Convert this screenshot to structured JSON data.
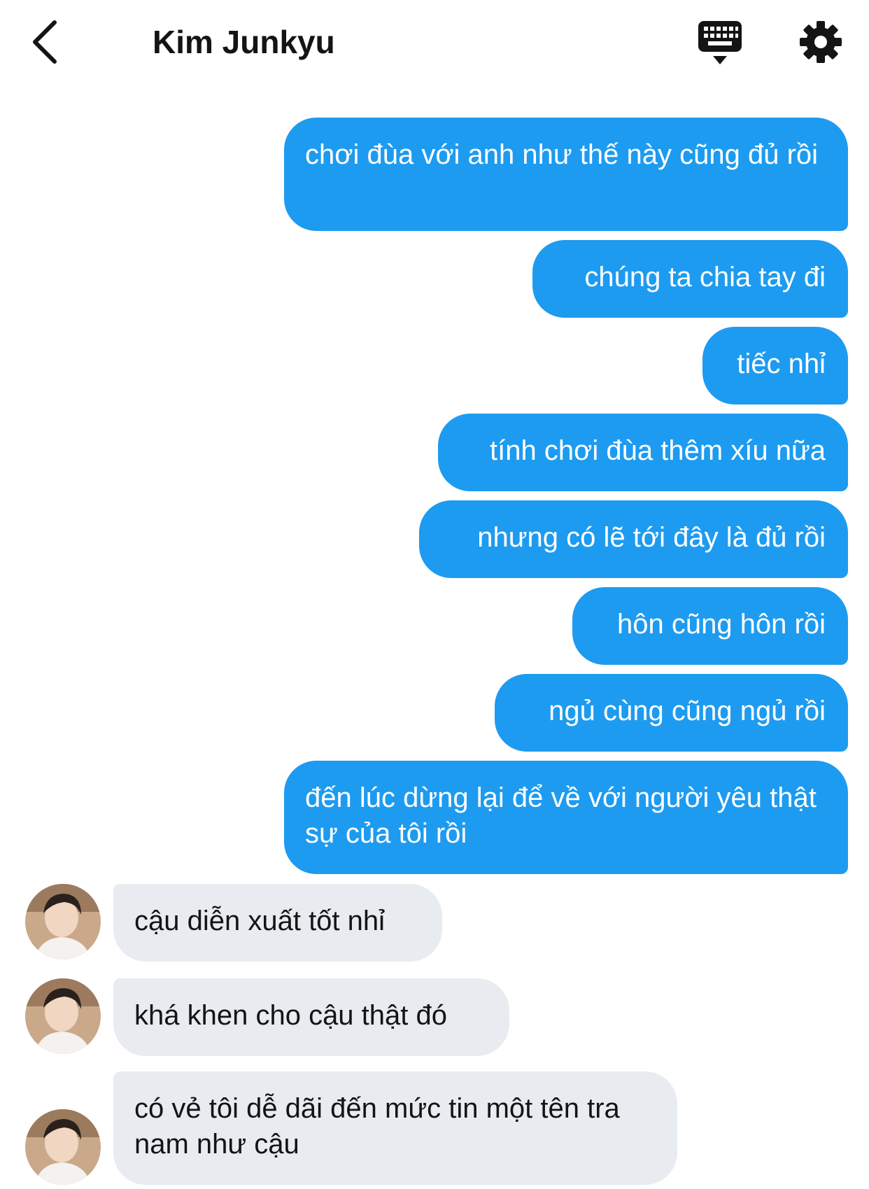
{
  "header": {
    "back_icon": "chevron-left-icon",
    "title": "Kim Junkyu",
    "keyboard_icon": "keyboard-icon",
    "settings_icon": "gear-icon"
  },
  "colors": {
    "sent_bubble": "#1d9bf0",
    "received_bubble": "#e8ecf1",
    "text_dark": "#141414"
  },
  "messages": [
    {
      "direction": "sent",
      "text": "chơi đùa với anh như thế này cũng đủ rồi"
    },
    {
      "direction": "sent",
      "text": "chúng ta chia tay đi"
    },
    {
      "direction": "sent",
      "text": "tiếc nhỉ"
    },
    {
      "direction": "sent",
      "text": "tính chơi đùa thêm xíu nữa"
    },
    {
      "direction": "sent",
      "text": "nhưng có lẽ tới đây là đủ rồi"
    },
    {
      "direction": "sent",
      "text": "hôn cũng hôn rồi"
    },
    {
      "direction": "sent",
      "text": "ngủ cùng cũng ngủ rồi"
    },
    {
      "direction": "sent",
      "text": "đến lúc dừng lại để về với người yêu thật sự của tôi rồi"
    },
    {
      "direction": "received",
      "text": "cậu diễn xuất tốt nhỉ"
    },
    {
      "direction": "received",
      "text": "khá khen cho cậu thật đó"
    },
    {
      "direction": "received",
      "text": "có vẻ tôi dễ dãi đến mức tin một tên tra nam như cậu"
    }
  ]
}
